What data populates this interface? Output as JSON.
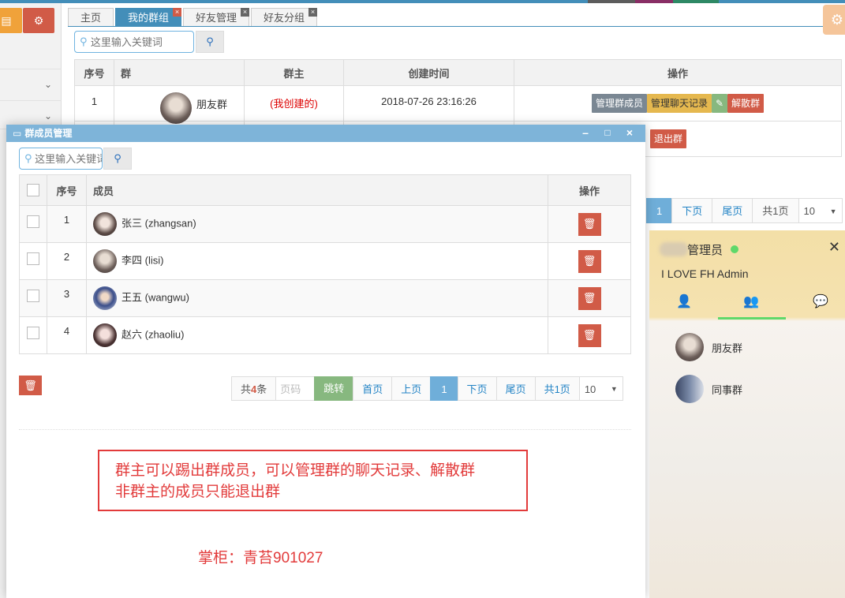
{
  "tabs": [
    {
      "label": "主页",
      "active": false
    },
    {
      "label": "我的群组",
      "active": true
    },
    {
      "label": "好友管理",
      "active": false
    },
    {
      "label": "好友分组",
      "active": false
    }
  ],
  "search": {
    "placeholder": "这里输入关键词"
  },
  "group_table": {
    "headers": [
      "序号",
      "群",
      "群主",
      "创建时间",
      "操作"
    ],
    "rows": [
      {
        "index": "1",
        "name": "朋友群",
        "owner": "(我创建的)",
        "created": "2018-07-26 23:16:26",
        "actions": [
          "管理群成员",
          "管理聊天记录",
          "解散群"
        ]
      },
      {
        "actions": [
          "退出群"
        ]
      }
    ]
  },
  "group_pager": {
    "current": "1",
    "next": "下页",
    "last": "尾页",
    "total": "共1页",
    "page_size": "10"
  },
  "modal": {
    "title": "群成员管理",
    "search_placeholder": "这里输入关键词",
    "headers": [
      "序号",
      "成员",
      "操作"
    ],
    "members": [
      {
        "index": "1",
        "label": "张三 (zhangsan)"
      },
      {
        "index": "2",
        "label": "李四 (lisi)"
      },
      {
        "index": "3",
        "label": "王五 (wangwu)"
      },
      {
        "index": "4",
        "label": "赵六 (zhaoliu)"
      }
    ],
    "pager": {
      "total_prefix": "共",
      "total_count": "4",
      "total_suffix": "条",
      "page_placeholder": "页码",
      "go": "跳转",
      "first": "首页",
      "prev": "上页",
      "current": "1",
      "next": "下页",
      "last": "尾页",
      "pages": "共1页",
      "page_size": "10"
    },
    "notice_line1": "群主可以踢出群成员，可以管理群的聊天记录、解散群",
    "notice_line2": "非群主的成员只能退出群",
    "signature": "掌柜：青苔901027"
  },
  "chat": {
    "name": "管理员",
    "signature": "I LOVE FH Admin",
    "groups": [
      "朋友群",
      "同事群"
    ]
  },
  "colors": {
    "brand": "#438eb9",
    "danger": "#d15b47",
    "notice": "#e23b3b",
    "online": "#5fd86a"
  }
}
